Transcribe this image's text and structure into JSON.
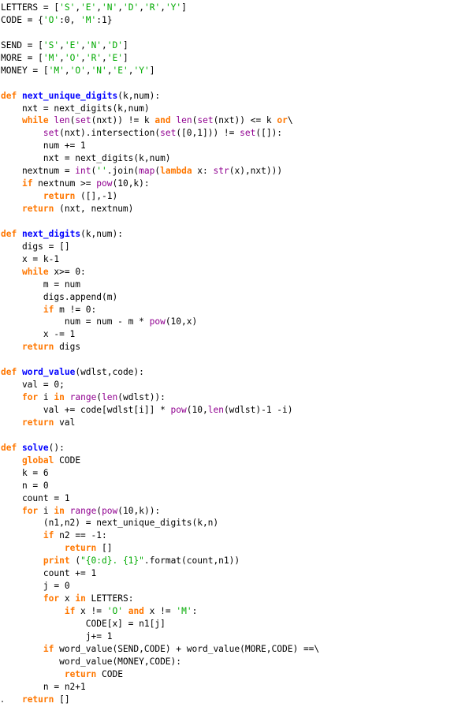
{
  "editor": {
    "language": "python",
    "background_color": "#ffffff",
    "default_text_color": "#000000",
    "syntax_colors": {
      "keyword": "#ff7700",
      "function_name": "#0000ff",
      "builtin": "#900090",
      "string": "#00aa00",
      "plain": "#000000"
    },
    "total_lines": 56
  },
  "code": {
    "lines": [
      [
        [
          "pl",
          "LETTERS = ["
        ],
        [
          "st",
          "'S'"
        ],
        [
          "pl",
          ","
        ],
        [
          "st",
          "'E'"
        ],
        [
          "pl",
          ","
        ],
        [
          "st",
          "'N'"
        ],
        [
          "pl",
          ","
        ],
        [
          "st",
          "'D'"
        ],
        [
          "pl",
          ","
        ],
        [
          "st",
          "'R'"
        ],
        [
          "pl",
          ","
        ],
        [
          "st",
          "'Y'"
        ],
        [
          "pl",
          "]"
        ]
      ],
      [
        [
          "pl",
          "CODE = {"
        ],
        [
          "st",
          "'O'"
        ],
        [
          "pl",
          ":0, "
        ],
        [
          "st",
          "'M'"
        ],
        [
          "pl",
          ":1}"
        ]
      ],
      [],
      [
        [
          "pl",
          "SEND = ["
        ],
        [
          "st",
          "'S'"
        ],
        [
          "pl",
          ","
        ],
        [
          "st",
          "'E'"
        ],
        [
          "pl",
          ","
        ],
        [
          "st",
          "'N'"
        ],
        [
          "pl",
          ","
        ],
        [
          "st",
          "'D'"
        ],
        [
          "pl",
          "]"
        ]
      ],
      [
        [
          "pl",
          "MORE = ["
        ],
        [
          "st",
          "'M'"
        ],
        [
          "pl",
          ","
        ],
        [
          "st",
          "'O'"
        ],
        [
          "pl",
          ","
        ],
        [
          "st",
          "'R'"
        ],
        [
          "pl",
          ","
        ],
        [
          "st",
          "'E'"
        ],
        [
          "pl",
          "]"
        ]
      ],
      [
        [
          "pl",
          "MONEY = ["
        ],
        [
          "st",
          "'M'"
        ],
        [
          "pl",
          ","
        ],
        [
          "st",
          "'O'"
        ],
        [
          "pl",
          ","
        ],
        [
          "st",
          "'N'"
        ],
        [
          "pl",
          ","
        ],
        [
          "st",
          "'E'"
        ],
        [
          "pl",
          ","
        ],
        [
          "st",
          "'Y'"
        ],
        [
          "pl",
          "]"
        ]
      ],
      [],
      [
        [
          "kw",
          "def"
        ],
        [
          "pl",
          " "
        ],
        [
          "fn",
          "next_unique_digits"
        ],
        [
          "pl",
          "(k,num):"
        ]
      ],
      [
        [
          "pl",
          "    nxt = next_digits(k,num)"
        ]
      ],
      [
        [
          "pl",
          "    "
        ],
        [
          "kw",
          "while"
        ],
        [
          "pl",
          " "
        ],
        [
          "bi",
          "len"
        ],
        [
          "pl",
          "("
        ],
        [
          "bi",
          "set"
        ],
        [
          "pl",
          "(nxt)) != k "
        ],
        [
          "kw",
          "and"
        ],
        [
          "pl",
          " "
        ],
        [
          "bi",
          "len"
        ],
        [
          "pl",
          "("
        ],
        [
          "bi",
          "set"
        ],
        [
          "pl",
          "(nxt)) <= k "
        ],
        [
          "kw",
          "or"
        ],
        [
          "pl",
          "\\"
        ]
      ],
      [
        [
          "pl",
          "        "
        ],
        [
          "bi",
          "set"
        ],
        [
          "pl",
          "(nxt).intersection("
        ],
        [
          "bi",
          "set"
        ],
        [
          "pl",
          "([0,1])) != "
        ],
        [
          "bi",
          "set"
        ],
        [
          "pl",
          "([]):"
        ]
      ],
      [
        [
          "pl",
          "        num += 1"
        ]
      ],
      [
        [
          "pl",
          "        nxt = next_digits(k,num)"
        ]
      ],
      [
        [
          "pl",
          "    nextnum = "
        ],
        [
          "bi",
          "int"
        ],
        [
          "pl",
          "("
        ],
        [
          "st",
          "''"
        ],
        [
          "pl",
          ".join("
        ],
        [
          "bi",
          "map"
        ],
        [
          "pl",
          "("
        ],
        [
          "kw",
          "lambda"
        ],
        [
          "pl",
          " x: "
        ],
        [
          "bi",
          "str"
        ],
        [
          "pl",
          "(x),nxt)))"
        ]
      ],
      [
        [
          "pl",
          "    "
        ],
        [
          "kw",
          "if"
        ],
        [
          "pl",
          " nextnum >= "
        ],
        [
          "bi",
          "pow"
        ],
        [
          "pl",
          "(10,k):"
        ]
      ],
      [
        [
          "pl",
          "        "
        ],
        [
          "kw",
          "return"
        ],
        [
          "pl",
          " ([],-1)"
        ]
      ],
      [
        [
          "pl",
          "    "
        ],
        [
          "kw",
          "return"
        ],
        [
          "pl",
          " (nxt, nextnum)"
        ]
      ],
      [],
      [
        [
          "kw",
          "def"
        ],
        [
          "pl",
          " "
        ],
        [
          "fn",
          "next_digits"
        ],
        [
          "pl",
          "(k,num):"
        ]
      ],
      [
        [
          "pl",
          "    digs = []"
        ]
      ],
      [
        [
          "pl",
          "    x = k-1"
        ]
      ],
      [
        [
          "pl",
          "    "
        ],
        [
          "kw",
          "while"
        ],
        [
          "pl",
          " x>= 0:"
        ]
      ],
      [
        [
          "pl",
          "        m = num"
        ]
      ],
      [
        [
          "pl",
          "        digs.append(m)"
        ]
      ],
      [
        [
          "pl",
          "        "
        ],
        [
          "kw",
          "if"
        ],
        [
          "pl",
          " m != 0:"
        ]
      ],
      [
        [
          "pl",
          "            num = num - m * "
        ],
        [
          "bi",
          "pow"
        ],
        [
          "pl",
          "(10,x)"
        ]
      ],
      [
        [
          "pl",
          "        x -= 1"
        ]
      ],
      [
        [
          "pl",
          "    "
        ],
        [
          "kw",
          "return"
        ],
        [
          "pl",
          " digs"
        ]
      ],
      [],
      [
        [
          "kw",
          "def"
        ],
        [
          "pl",
          " "
        ],
        [
          "fn",
          "word_value"
        ],
        [
          "pl",
          "(wdlst,code):"
        ]
      ],
      [
        [
          "pl",
          "    val = 0;"
        ]
      ],
      [
        [
          "pl",
          "    "
        ],
        [
          "kw",
          "for"
        ],
        [
          "pl",
          " i "
        ],
        [
          "kw",
          "in"
        ],
        [
          "pl",
          " "
        ],
        [
          "bi",
          "range"
        ],
        [
          "pl",
          "("
        ],
        [
          "bi",
          "len"
        ],
        [
          "pl",
          "(wdlst)):"
        ]
      ],
      [
        [
          "pl",
          "        val += code[wdlst[i]] * "
        ],
        [
          "bi",
          "pow"
        ],
        [
          "pl",
          "(10,"
        ],
        [
          "bi",
          "len"
        ],
        [
          "pl",
          "(wdlst)-1 -i)"
        ]
      ],
      [
        [
          "pl",
          "    "
        ],
        [
          "kw",
          "return"
        ],
        [
          "pl",
          " val"
        ]
      ],
      [],
      [
        [
          "kw",
          "def"
        ],
        [
          "pl",
          " "
        ],
        [
          "fn",
          "solve"
        ],
        [
          "pl",
          "():"
        ]
      ],
      [
        [
          "pl",
          "    "
        ],
        [
          "kw",
          "global"
        ],
        [
          "pl",
          " CODE"
        ]
      ],
      [
        [
          "pl",
          "    k = 6"
        ]
      ],
      [
        [
          "pl",
          "    n = 0"
        ]
      ],
      [
        [
          "pl",
          "    count = 1"
        ]
      ],
      [
        [
          "pl",
          "    "
        ],
        [
          "kw",
          "for"
        ],
        [
          "pl",
          " i "
        ],
        [
          "kw",
          "in"
        ],
        [
          "pl",
          " "
        ],
        [
          "bi",
          "range"
        ],
        [
          "pl",
          "("
        ],
        [
          "bi",
          "pow"
        ],
        [
          "pl",
          "(10,k)):"
        ]
      ],
      [
        [
          "pl",
          "        (n1,n2) = next_unique_digits(k,n)"
        ]
      ],
      [
        [
          "pl",
          "        "
        ],
        [
          "kw",
          "if"
        ],
        [
          "pl",
          " n2 == -1:"
        ]
      ],
      [
        [
          "pl",
          "            "
        ],
        [
          "kw",
          "return"
        ],
        [
          "pl",
          " []"
        ]
      ],
      [
        [
          "pl",
          "        "
        ],
        [
          "kw",
          "print"
        ],
        [
          "pl",
          " ("
        ],
        [
          "st",
          "\"{0:d}. {1}\""
        ],
        [
          "pl",
          ".format(count,n1))"
        ]
      ],
      [
        [
          "pl",
          "        count += 1"
        ]
      ],
      [
        [
          "pl",
          "        j = 0"
        ]
      ],
      [
        [
          "pl",
          "        "
        ],
        [
          "kw",
          "for"
        ],
        [
          "pl",
          " x "
        ],
        [
          "kw",
          "in"
        ],
        [
          "pl",
          " LETTERS:"
        ]
      ],
      [
        [
          "pl",
          "            "
        ],
        [
          "kw",
          "if"
        ],
        [
          "pl",
          " x != "
        ],
        [
          "st",
          "'O'"
        ],
        [
          "pl",
          " "
        ],
        [
          "kw",
          "and"
        ],
        [
          "pl",
          " x != "
        ],
        [
          "st",
          "'M'"
        ],
        [
          "pl",
          ":"
        ]
      ],
      [
        [
          "pl",
          "                CODE[x] = n1[j]"
        ]
      ],
      [
        [
          "pl",
          "                j+= 1"
        ]
      ],
      [
        [
          "pl",
          "        "
        ],
        [
          "kw",
          "if"
        ],
        [
          "pl",
          " word_value(SEND,CODE) + word_value(MORE,CODE) ==\\"
        ]
      ],
      [
        [
          "pl",
          "           word_value(MONEY,CODE):"
        ]
      ],
      [
        [
          "pl",
          "            "
        ],
        [
          "kw",
          "return"
        ],
        [
          "pl",
          " CODE"
        ]
      ],
      [
        [
          "pl",
          "        n = n2+1"
        ]
      ],
      [
        [
          "pl",
          "    "
        ],
        [
          "kw",
          "return"
        ],
        [
          "pl",
          " []"
        ]
      ]
    ]
  }
}
